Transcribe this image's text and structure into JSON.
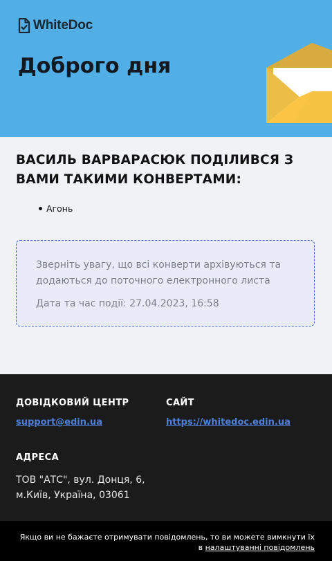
{
  "header": {
    "logo_text": "WhiteDoc",
    "greeting": "Доброго дня",
    "background_color": "#51afe5",
    "icons": [
      "document-logo-icon",
      "envelope-illustration-icon"
    ]
  },
  "main": {
    "title": "ВАСИЛЬ ВАРВАРАСЮК ПОДІЛИВСЯ З ВАМИ ТАКИМИ КОНВЕРТАМИ:",
    "envelopes": [
      {
        "label": "Агонь"
      }
    ],
    "notice": {
      "text": "Зверніть увагу, що всі конверти архівуються та додаються до поточного електронного листа",
      "event_date": "Дата та час події: 27.04.2023, 16:58"
    }
  },
  "footer": {
    "help_center": {
      "title": "ДОВІДКОВИЙ ЦЕНТР",
      "email": "support@edin.ua"
    },
    "site": {
      "title": "САЙТ",
      "url": "https://whitedoc.edin.ua"
    },
    "address": {
      "title": "АДРЕСА",
      "text": "ТОВ \"АТС\", вул. Донця, 6, м.Київ, Україна, 03061"
    },
    "link_color": "#4f7fd8"
  },
  "unsubscribe": {
    "text_before": "Якщо ви не бажаєте отримувати повідомлень, то ви можете вимкнути їх в",
    "link_text": "налаштуванні повідомлень"
  }
}
